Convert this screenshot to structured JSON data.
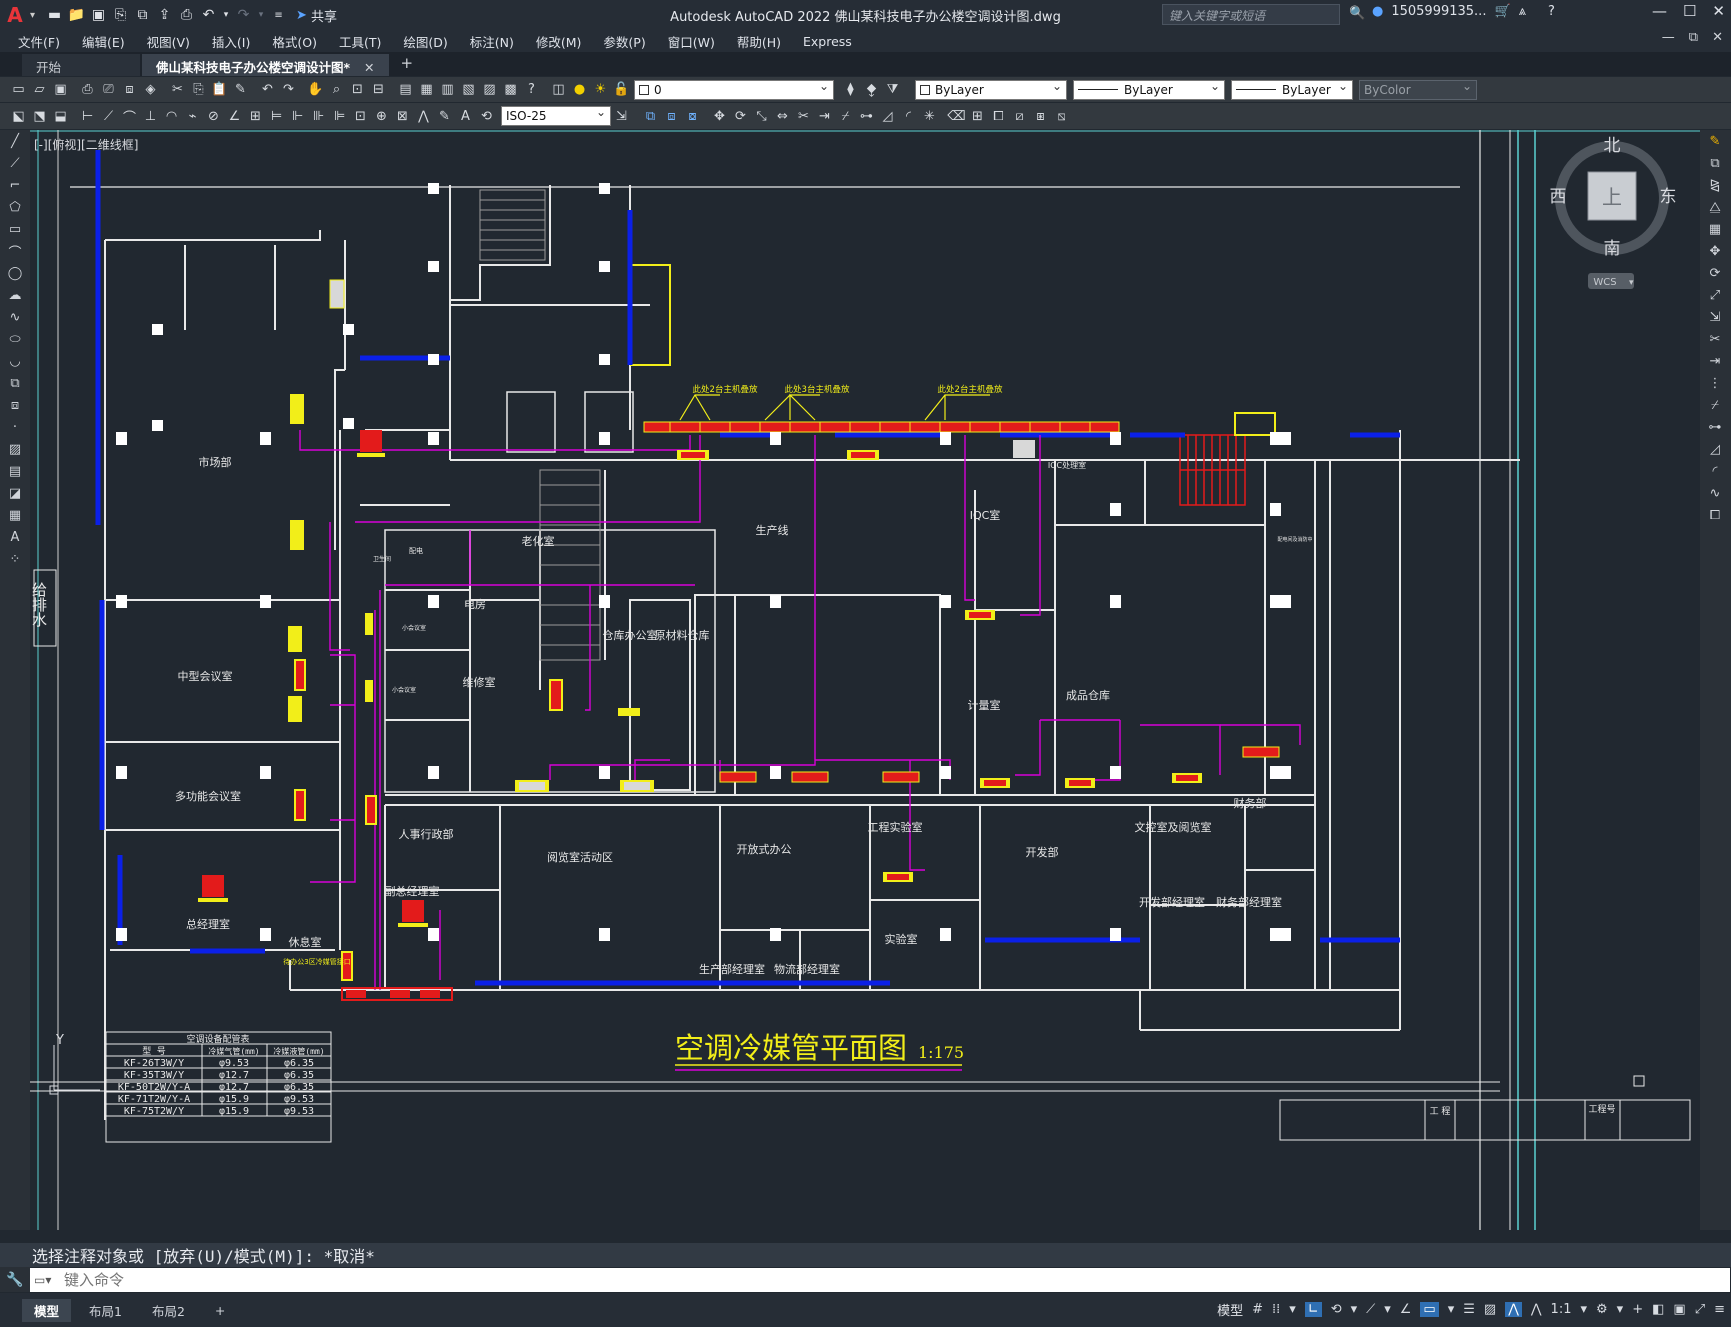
{
  "app": {
    "logo": "A",
    "share_label": "共享",
    "title": "Autodesk AutoCAD 2022    佛山某科技电子办公楼空调设计图.dwg",
    "search_placeholder": "键入关键字或短语",
    "user": "1505999135...",
    "window_buttons": [
      "—",
      "☐",
      "✕"
    ],
    "mdi_buttons": [
      "—",
      "⧉",
      "✕"
    ]
  },
  "menu": [
    "文件(F)",
    "编辑(E)",
    "视图(V)",
    "插入(I)",
    "格式(O)",
    "工具(T)",
    "绘图(D)",
    "标注(N)",
    "修改(M)",
    "参数(P)",
    "窗口(W)",
    "帮助(H)",
    "Express"
  ],
  "tabs": [
    {
      "label": "开始",
      "active": false
    },
    {
      "label": "佛山某科技电子办公楼空调设计图*",
      "active": true
    }
  ],
  "toolbar": {
    "layer_value": "0",
    "color_value": "ByLayer",
    "linetype_value": "ByLayer",
    "lineweight_value": "ByLayer",
    "plotstyle_value": "ByColor",
    "dimstyle_value": "ISO-25"
  },
  "viewport": {
    "label": "[-][俯视][二维线框]",
    "viewcube": {
      "north": "北",
      "south": "南",
      "east": "东",
      "west": "西",
      "face": "上",
      "wcs": "WCS"
    },
    "vertical_label": "给排水",
    "ucs_y": "Y"
  },
  "plan": {
    "title": "空调冷媒管平面图",
    "scale": "1:175",
    "rooms": [
      "市场部",
      "中型会议室",
      "多功能会议室",
      "总经理室",
      "休息室",
      "老化室",
      "电房",
      "维修室",
      "仓库办公室",
      "原材料仓库",
      "生产线",
      "IQC室",
      "计量室",
      "成品仓库",
      "IQC处理室",
      "人事行政部",
      "副总经理室",
      "阅览室活动区",
      "开放式办公",
      "生产部经理室",
      "物流部经理室",
      "工程实验室",
      "实验室",
      "开发部",
      "文控室及阅览室",
      "财务部",
      "开发部经理室",
      "财务部经理室"
    ],
    "small_labels": [
      "卫生间",
      "配电",
      "小会议室",
      "小会议室",
      "配电间及消防中"
    ],
    "notes": [
      "此处2台主机叠放",
      "此处3台主机叠放",
      "此处2台主机叠放",
      "待办公3区冷媒管接口"
    ]
  },
  "legend_table": {
    "title": "空调设备配管表",
    "headers": [
      "型    号",
      "冷媒气管(mm)",
      "冷媒液管(mm)"
    ],
    "rows": [
      [
        "KF-26T3W/Y",
        "φ9.53",
        "φ6.35"
      ],
      [
        "KF-35T3W/Y",
        "φ12.7",
        "φ6.35"
      ],
      [
        "KF-50T2W/Y-A",
        "φ12.7",
        "φ6.35"
      ],
      [
        "KF-71T2W/Y-A",
        "φ15.9",
        "φ9.53"
      ],
      [
        "KF-75T2W/Y",
        "φ15.9",
        "φ9.53"
      ]
    ]
  },
  "titleblock": {
    "label1": "工 程",
    "label2": "工程号"
  },
  "command": {
    "history": "选择注释对象或 [放弃(U)/模式(M)]: *取消*",
    "placeholder": "键入命令"
  },
  "layout_tabs": [
    {
      "label": "模型",
      "active": true
    },
    {
      "label": "布局1",
      "active": false
    },
    {
      "label": "布局2",
      "active": false
    }
  ],
  "status": {
    "model": "模型",
    "scale": "1:1"
  },
  "colors": {
    "wall": "#e8e8e8",
    "pipe_blue": "#0b20e8",
    "pipe_magenta": "#d800d8",
    "unit_red": "#e31b1b",
    "unit_yellow": "#f2ee19",
    "annotation": "#f2ee19",
    "canvas": "#212830"
  }
}
